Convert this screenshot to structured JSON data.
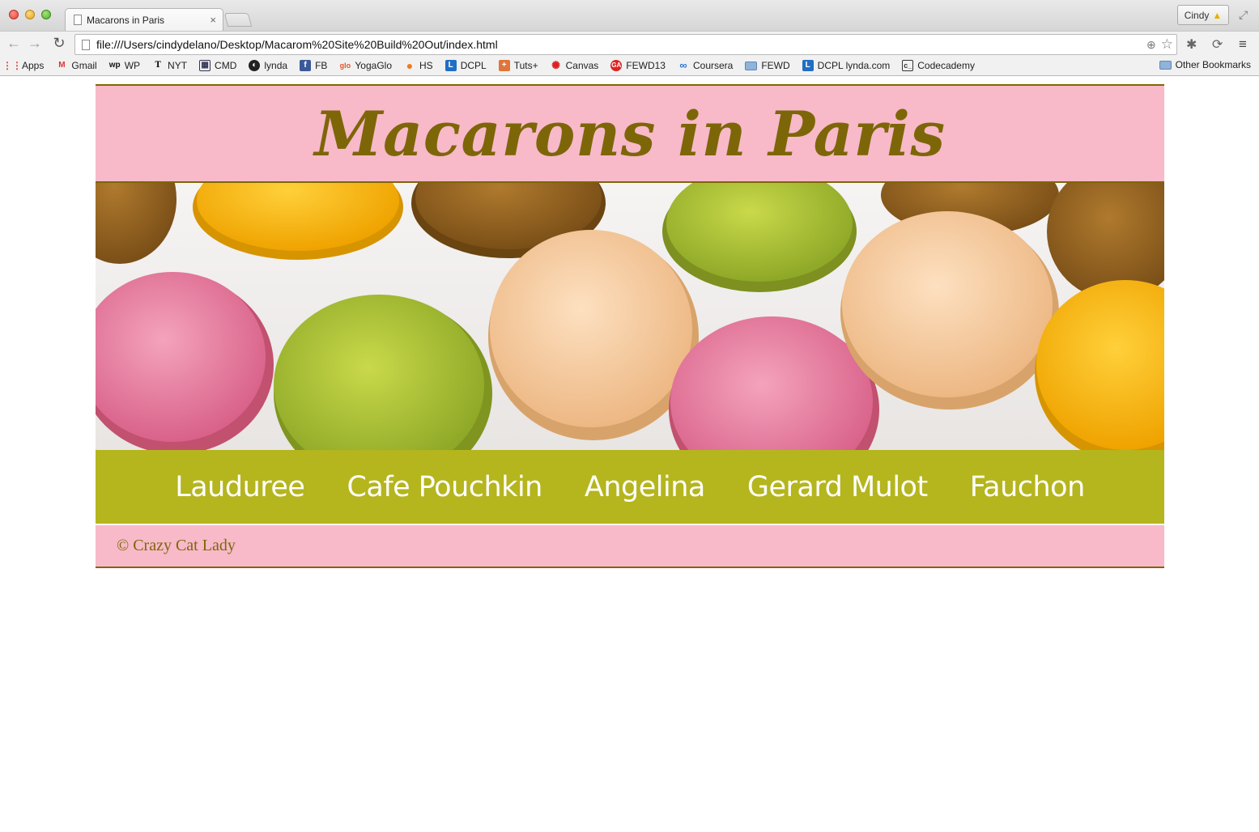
{
  "browser": {
    "tab_title": "Macarons in Paris",
    "tab_close": "×",
    "profile_name": "Cindy",
    "url": "file:///Users/cindydelano/Desktop/Macarom%20Site%20Build%20Out/index.html",
    "bookmarks": [
      {
        "label": "Apps",
        "icon": "apps-grid-icon"
      },
      {
        "label": "Gmail",
        "icon": "gmail-icon"
      },
      {
        "label": "WP",
        "icon": "wp-icon"
      },
      {
        "label": "NYT",
        "icon": "nyt-icon"
      },
      {
        "label": "CMD",
        "icon": "cmd-icon"
      },
      {
        "label": "lynda",
        "icon": "lynda-icon"
      },
      {
        "label": "FB",
        "icon": "facebook-icon"
      },
      {
        "label": "YogaGlo",
        "icon": "yogaglo-icon"
      },
      {
        "label": "HS",
        "icon": "hs-icon"
      },
      {
        "label": "DCPL",
        "icon": "dcpl-icon"
      },
      {
        "label": "Tuts+",
        "icon": "tuts-icon"
      },
      {
        "label": "Canvas",
        "icon": "canvas-icon"
      },
      {
        "label": "FEWD13",
        "icon": "fewd13-icon"
      },
      {
        "label": "Coursera",
        "icon": "coursera-icon"
      },
      {
        "label": "FEWD",
        "icon": "folder-icon"
      },
      {
        "label": "DCPL lynda.com",
        "icon": "dcpl-icon"
      },
      {
        "label": "Codecademy",
        "icon": "codecademy-icon"
      }
    ],
    "other_bookmarks": "Other Bookmarks"
  },
  "site": {
    "title": "Macarons in Paris",
    "nav": [
      "Lauduree",
      "Cafe Pouchkin",
      "Angelina",
      "Gerard Mulot",
      "Fauchon"
    ],
    "footer": "© Crazy Cat Lady"
  },
  "colors": {
    "pink": "#f8b9c9",
    "olive_text": "#7d6608",
    "nav_green": "#b5b51e"
  }
}
